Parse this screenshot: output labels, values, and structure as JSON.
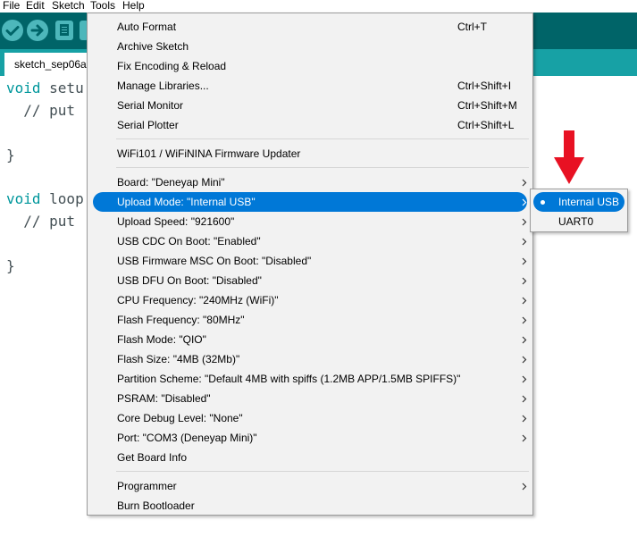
{
  "menubar": {
    "file": "File",
    "edit": "Edit",
    "sketch": "Sketch",
    "tools": "Tools",
    "help": "Help"
  },
  "toolbar": {
    "verify_icon": "check-icon",
    "upload_icon": "arrow-right-icon",
    "new_icon": "new-sketch-icon"
  },
  "tab": {
    "label": "sketch_sep06a"
  },
  "editor": {
    "line1_kw": "void",
    "line1_rest": " setu",
    "line2": "  // put",
    "line3": "}",
    "line4_kw": "void",
    "line4_rest": " loop",
    "line5": "  // put",
    "line6": "}"
  },
  "tools_menu": {
    "items": [
      {
        "label": "Auto Format",
        "shortcut": "Ctrl+T"
      },
      {
        "label": "Archive Sketch",
        "shortcut": ""
      },
      {
        "label": "Fix Encoding & Reload",
        "shortcut": ""
      },
      {
        "label": "Manage Libraries...",
        "shortcut": "Ctrl+Shift+I"
      },
      {
        "label": "Serial Monitor",
        "shortcut": "Ctrl+Shift+M"
      },
      {
        "label": "Serial Plotter",
        "shortcut": "Ctrl+Shift+L"
      },
      {
        "label": "WiFi101 / WiFiNINA Firmware Updater",
        "shortcut": ""
      },
      {
        "label": "Board: \"Deneyap Mini\"",
        "shortcut": ""
      },
      {
        "label": "Upload Mode: \"Internal USB\"",
        "shortcut": ""
      },
      {
        "label": "Upload Speed: \"921600\"",
        "shortcut": ""
      },
      {
        "label": "USB CDC On Boot: \"Enabled\"",
        "shortcut": ""
      },
      {
        "label": "USB Firmware MSC On Boot: \"Disabled\"",
        "shortcut": ""
      },
      {
        "label": "USB DFU On Boot: \"Disabled\"",
        "shortcut": ""
      },
      {
        "label": "CPU Frequency: \"240MHz (WiFi)\"",
        "shortcut": ""
      },
      {
        "label": "Flash Frequency: \"80MHz\"",
        "shortcut": ""
      },
      {
        "label": "Flash Mode: \"QIO\"",
        "shortcut": ""
      },
      {
        "label": "Flash Size: \"4MB (32Mb)\"",
        "shortcut": ""
      },
      {
        "label": "Partition Scheme: \"Default 4MB with spiffs (1.2MB APP/1.5MB SPIFFS)\"",
        "shortcut": ""
      },
      {
        "label": "PSRAM: \"Disabled\"",
        "shortcut": ""
      },
      {
        "label": "Core Debug Level: \"None\"",
        "shortcut": ""
      },
      {
        "label": "Port: \"COM3 (Deneyap Mini)\"",
        "shortcut": ""
      },
      {
        "label": "Get Board Info",
        "shortcut": ""
      },
      {
        "label": "Programmer",
        "shortcut": ""
      },
      {
        "label": "Burn Bootloader",
        "shortcut": ""
      }
    ],
    "highlight_color": "#0078d7"
  },
  "upload_mode_submenu": {
    "items": [
      {
        "label": "Internal USB",
        "selected": true
      },
      {
        "label": "UART0",
        "selected": false
      }
    ]
  },
  "annotation": {
    "icon": "red-down-arrow-icon",
    "color": "#e81123"
  },
  "colors": {
    "toolbar": "#006468",
    "tabbar": "#17a1a5",
    "button": "#4db7bb",
    "keyword": "#00979c"
  }
}
